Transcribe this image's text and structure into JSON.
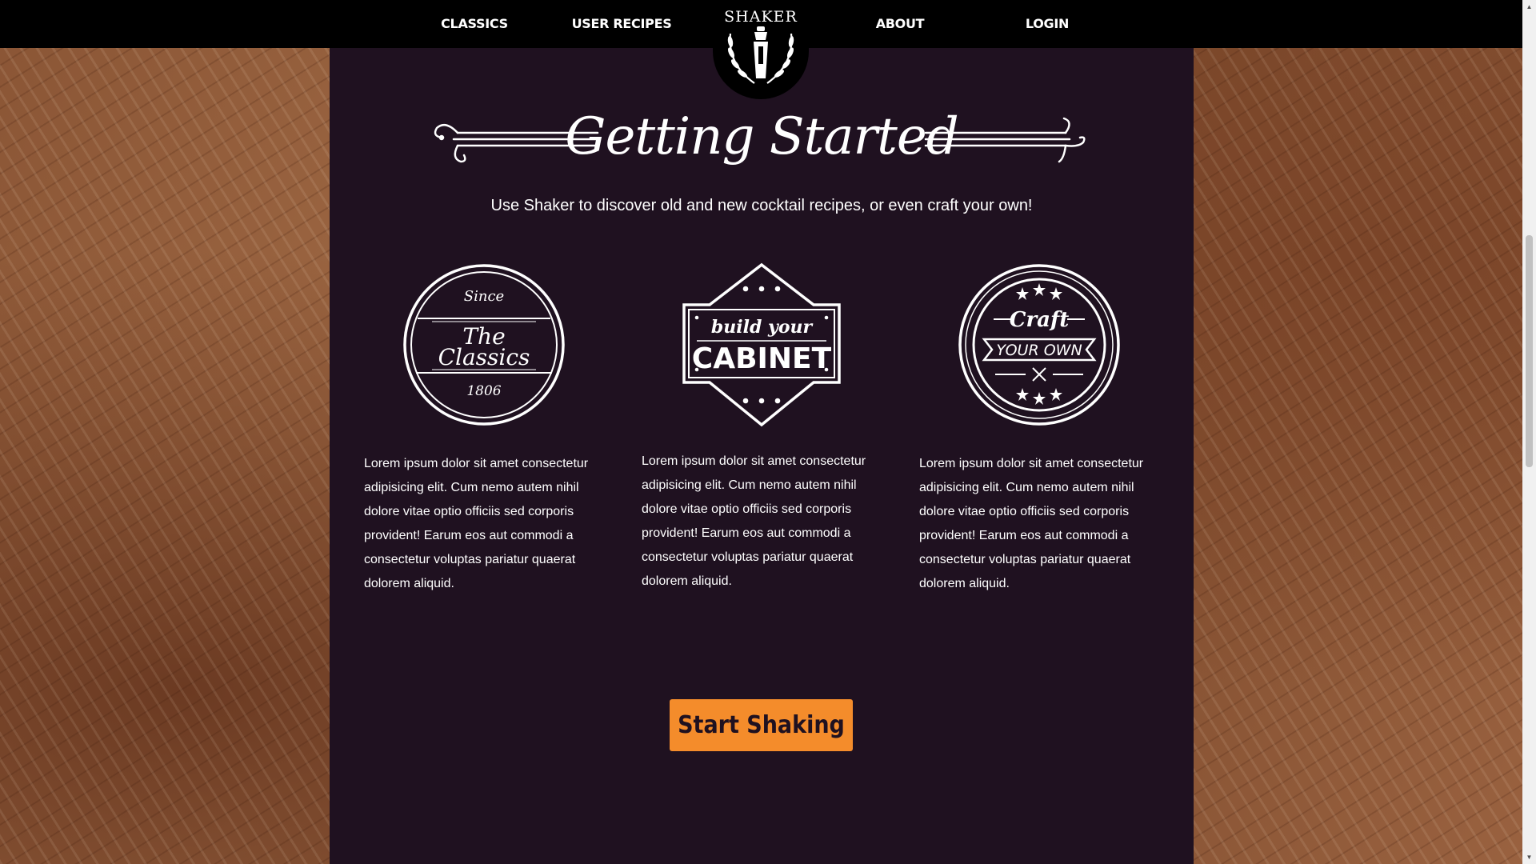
{
  "nav": {
    "items": [
      {
        "label": "CLASSICS"
      },
      {
        "label": "USER RECIPES"
      },
      {
        "label": "ABOUT"
      },
      {
        "label": "LOGIN"
      }
    ],
    "logo_text": "SHAKER"
  },
  "hero": {
    "title": "Getting Started",
    "subtitle": "Use Shaker to discover old and new cocktail recipes, or even craft your own!"
  },
  "cards": [
    {
      "badge": {
        "line1": "Since",
        "line2": "The",
        "line3": "Classics",
        "line4": "1806"
      },
      "text": "Lorem ipsum dolor sit amet consectetur adipisicing elit. Cum nemo autem nihil dolore vitae optio officiis sed corporis provident! Earum eos aut commodi a consectetur voluptas pariatur quaerat dolorem aliquid."
    },
    {
      "badge": {
        "line1": "build your",
        "line2": "CABINET"
      },
      "text": "Lorem ipsum dolor sit amet consectetur adipisicing elit. Cum nemo autem nihil dolore vitae optio officiis sed corporis provident! Earum eos aut commodi a consectetur voluptas pariatur quaerat dolorem aliquid."
    },
    {
      "badge": {
        "line1": "Craft",
        "line2": "YOUR OWN"
      },
      "text": "Lorem ipsum dolor sit amet consectetur adipisicing elit. Cum nemo autem nihil dolore vitae optio officiis sed corporis provident! Earum eos aut commodi a consectetur voluptas pariatur quaerat dolorem aliquid."
    }
  ],
  "cta": {
    "label": "Start Shaking"
  },
  "colors": {
    "panel": "#1f1120",
    "accent": "#f48c2b",
    "nav": "#000000"
  },
  "icons": [
    "shaker-logo-icon",
    "wreath-icon",
    "star-icon",
    "crossed-swizzles-icon"
  ]
}
